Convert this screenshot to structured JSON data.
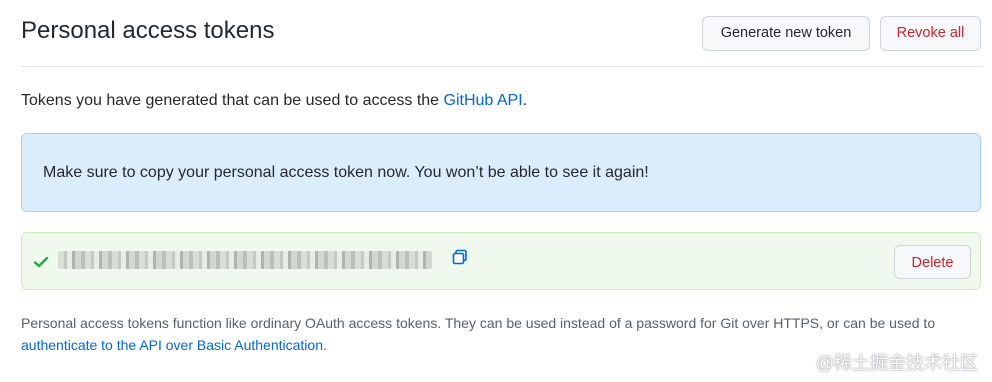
{
  "header": {
    "title": "Personal access tokens",
    "generate_label": "Generate new token",
    "revoke_label": "Revoke all"
  },
  "intro": {
    "text": "Tokens you have generated that can be used to access the ",
    "link_text": "GitHub API",
    "suffix": "."
  },
  "flash": {
    "message": "Make sure to copy your personal access token now. You won’t be able to see it again!"
  },
  "token": {
    "delete_label": "Delete",
    "status_icon": "check-icon",
    "copy_icon": "clipboard-icon"
  },
  "footnote": {
    "text": "Personal access tokens function like ordinary OAuth access tokens. They can be used instead of a password for Git over HTTPS, or can be used to ",
    "link_text": "authenticate to the API over Basic Authentication",
    "suffix": "."
  },
  "watermark": {
    "text": "@稀土掘金技术社区"
  },
  "colors": {
    "link": "#0366d6",
    "danger": "#cb2431",
    "info_bg": "#dbedfa",
    "success_bg": "#f0f9ed",
    "success_icon": "#28a745"
  }
}
